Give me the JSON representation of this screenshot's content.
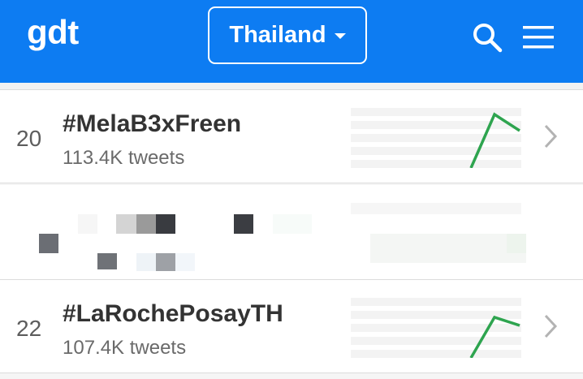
{
  "header": {
    "logo": "gdt",
    "country": "Thailand",
    "search_icon": "search-icon",
    "menu_icon": "menu-icon",
    "bar_color": "#0d7cf2"
  },
  "trends": [
    {
      "rank": "20",
      "tag": "#MelaB3xFreen",
      "tweets": "113.4K tweets"
    },
    {
      "rank": "22",
      "tag": "#LaRochePosayTH",
      "tweets": "107.4K tweets"
    }
  ],
  "sparkline_color": "#2ea44f"
}
